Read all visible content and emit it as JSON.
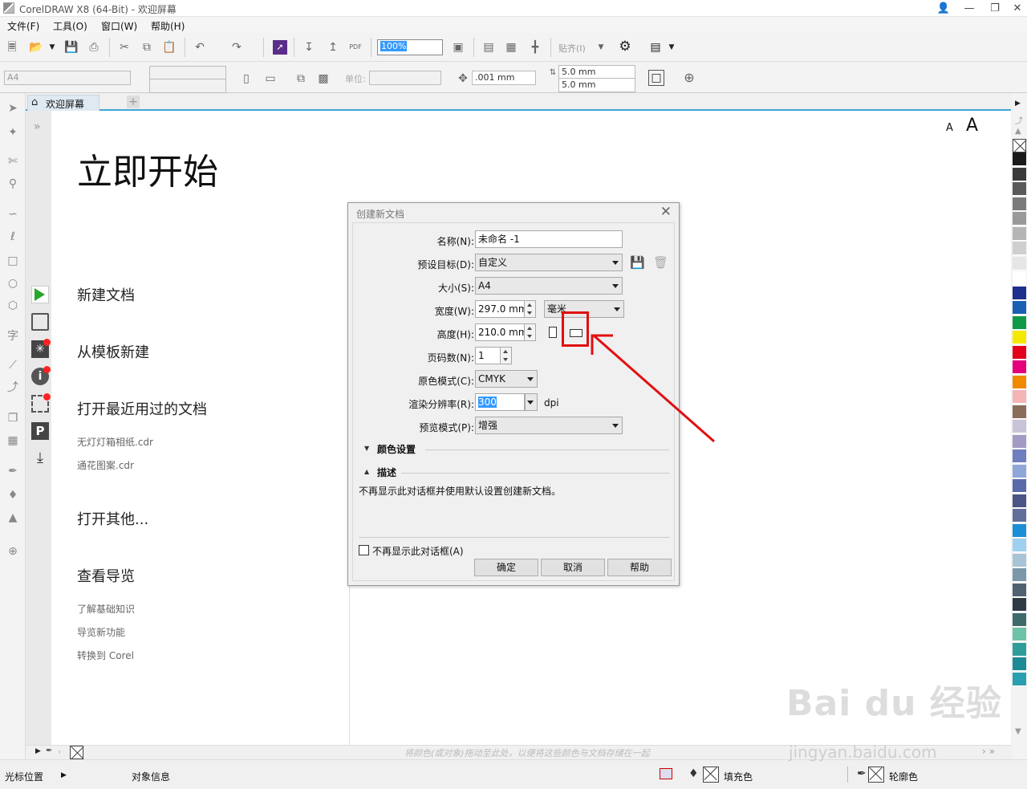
{
  "window": {
    "title": "CorelDRAW X8 (64-Bit) - 欢迎屏幕"
  },
  "menu": [
    "文件(F)",
    "工具(O)",
    "窗口(W)",
    "帮助(H)"
  ],
  "toolbar": {
    "zoom": "100%",
    "snap_label": "贴齐(I)"
  },
  "propbar": {
    "page_size": "A4",
    "units_label": "单位:",
    "nudge": ".001 mm",
    "dup_x": "5.0 mm",
    "dup_y": "5.0 mm"
  },
  "tab": {
    "label": "欢迎屏幕"
  },
  "welcome": {
    "heading": "立即开始",
    "items": {
      "new_doc": "新建文档",
      "from_template": "从模板新建",
      "open_recent": "打开最近用过的文档",
      "recent1": "无灯灯箱相纸.cdr",
      "recent2": "通花图案.cdr",
      "open_other": "打开其他...",
      "tour": "查看导览",
      "tour1": "了解基础知识",
      "tour2": "导览新功能",
      "tour3": "转换到 Corel"
    },
    "font_small": "A",
    "font_large": "A"
  },
  "dialog": {
    "title": "创建新文档",
    "name_label": "名称(N):",
    "name_value": "未命名 -1",
    "preset_label": "预设目标(D):",
    "preset_value": "自定义",
    "size_label": "大小(S):",
    "size_value": "A4",
    "width_label": "宽度(W):",
    "width_value": "297.0 mm",
    "unit_value": "毫米",
    "height_label": "高度(H):",
    "height_value": "210.0 mm",
    "pages_label": "页码数(N):",
    "pages_value": "1",
    "color_mode_label": "原色模式(C):",
    "color_mode_value": "CMYK",
    "res_label": "渲染分辨率(R):",
    "res_value": "300",
    "res_unit": "dpi",
    "preview_label": "预览模式(P):",
    "preview_value": "增强",
    "color_settings": "颜色设置",
    "description": "描述",
    "description_text": "不再显示此对话框并使用默认设置创建新文档。",
    "dont_show": "不再显示此对话框(A)",
    "ok": "确定",
    "cancel": "取消",
    "help": "帮助"
  },
  "bottom_hint": "将颜色(或对象)拖动至此处，以便将这些颜色与文档存储在一起",
  "status": {
    "cursor": "光标位置",
    "object_info": "对象信息",
    "fill": "填充色",
    "outline": "轮廓色"
  },
  "watermark": {
    "main": "Bai du 经验",
    "url": "jingyan.baidu.com"
  },
  "palette": [
    "#1a1a1a",
    "#3a3a3a",
    "#5a5a5a",
    "#7a7a7a",
    "#999999",
    "#b5b5b5",
    "#cfcfcf",
    "#e6e6e6",
    "#ffffff",
    "#1f2f8c",
    "#1a5fb4",
    "#109a48",
    "#f5e800",
    "#e3001b",
    "#e3007a",
    "#f08a00",
    "#f5b5b5",
    "#8a6c5a",
    "#c9c3d9",
    "#a39bc4",
    "#6e7fbf",
    "#8fa6d9",
    "#5a6aa8",
    "#4a5584",
    "#5f6f9a",
    "#1a8fd6",
    "#9fd0ef",
    "#a8c4d6",
    "#7a98aa",
    "#4e6272",
    "#2e3b44",
    "#3e6a6a",
    "#6ec2a8",
    "#2f9e9a",
    "#1e8a94",
    "#2a9fb0"
  ]
}
